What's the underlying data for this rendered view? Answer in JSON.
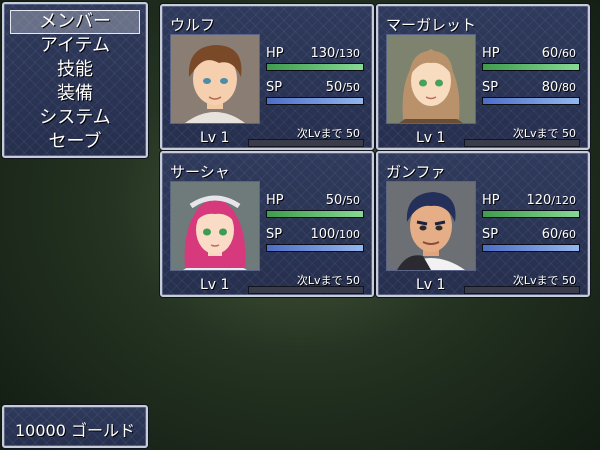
{
  "menu": {
    "items": [
      {
        "label": "メンバー",
        "selected": true
      },
      {
        "label": "アイテム",
        "selected": false
      },
      {
        "label": "技能",
        "selected": false
      },
      {
        "label": "装備",
        "selected": false
      },
      {
        "label": "システム",
        "selected": false
      },
      {
        "label": "セーブ",
        "selected": false
      }
    ]
  },
  "party": [
    {
      "name": "ウルフ",
      "hp_label": "HP",
      "hp": "130",
      "hp_max": "/130",
      "hp_ratio": 1.0,
      "sp_label": "SP",
      "sp": "50",
      "sp_max": "/50",
      "sp_ratio": 1.0,
      "level": "Lv 1",
      "next_exp": "次Lvまで 50",
      "portrait": "brown-haired-young-man"
    },
    {
      "name": "マーガレット",
      "hp_label": "HP",
      "hp": "60",
      "hp_max": "/60",
      "hp_ratio": 1.0,
      "sp_label": "SP",
      "sp": "80",
      "sp_max": "/80",
      "sp_ratio": 1.0,
      "level": "Lv 1",
      "next_exp": "次Lvまで 50",
      "portrait": "light-brown-haired-woman"
    },
    {
      "name": "サーシャ",
      "hp_label": "HP",
      "hp": "50",
      "hp_max": "/50",
      "hp_ratio": 1.0,
      "sp_label": "SP",
      "sp": "100",
      "sp_max": "/100",
      "sp_ratio": 1.0,
      "level": "Lv 1",
      "next_exp": "次Lvまで 50",
      "portrait": "pink-haired-girl"
    },
    {
      "name": "ガンファ",
      "hp_label": "HP",
      "hp": "120",
      "hp_max": "/120",
      "hp_ratio": 1.0,
      "sp_label": "SP",
      "sp": "60",
      "sp_max": "/60",
      "sp_ratio": 1.0,
      "level": "Lv 1",
      "next_exp": "次Lvまで 50",
      "portrait": "dark-haired-old-man"
    }
  ],
  "gold": {
    "text": "10000 ゴールド"
  },
  "colors": {
    "window": "#2b3556",
    "hp_gauge": "#6fcf7f",
    "sp_gauge": "#7ea8ee"
  }
}
